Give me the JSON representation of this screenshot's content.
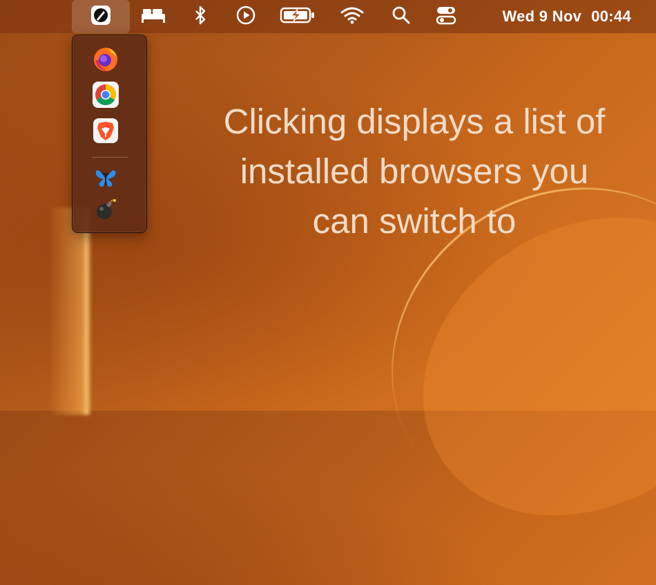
{
  "menubar": {
    "date": "Wed 9 Nov",
    "time": "00:44",
    "icons": [
      "browser-switcher-icon",
      "bed-icon",
      "bluetooth-icon",
      "play-icon",
      "battery-charging-icon",
      "wifi-icon",
      "search-icon",
      "control-center-icon"
    ]
  },
  "dropdown": {
    "browsers": [
      "firefox-icon",
      "chrome-icon",
      "brave-icon"
    ],
    "extras": [
      "butterfly-icon",
      "bomb-icon"
    ]
  },
  "headline": {
    "line1": "Clicking displays a list of",
    "line2": "installed browsers you",
    "line3": "can switch to"
  }
}
